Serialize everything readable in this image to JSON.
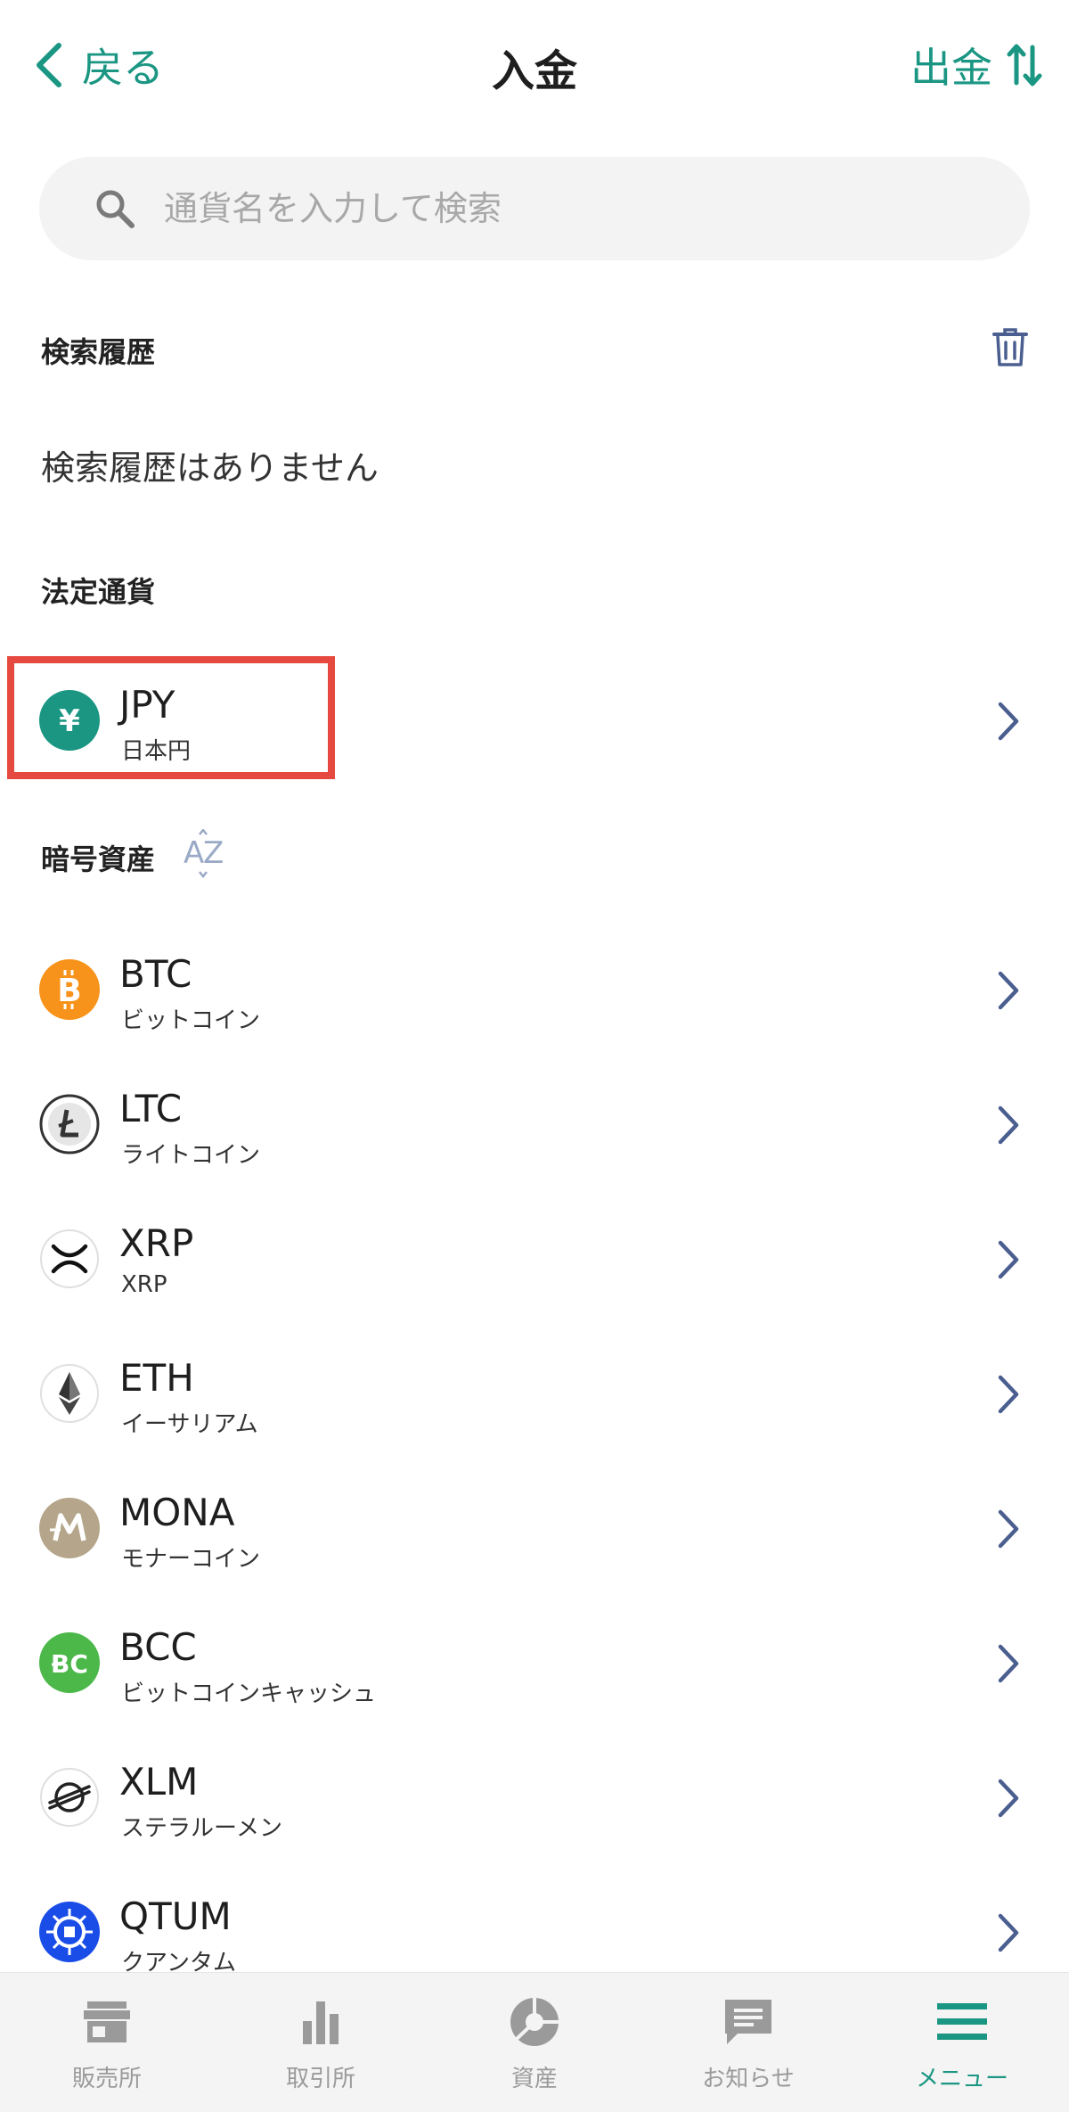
{
  "header": {
    "back_label": "戻る",
    "title": "入金",
    "withdraw_label": "出金"
  },
  "search": {
    "placeholder": "通貨名を入力して検索"
  },
  "history": {
    "title": "検索履歴",
    "empty": "検索履歴はありません"
  },
  "fiat": {
    "title": "法定通貨",
    "items": [
      {
        "code": "JPY",
        "name": "日本円",
        "icon": "yen-icon",
        "color": "#1a9683"
      }
    ]
  },
  "crypto": {
    "title": "暗号資産",
    "sort_icon": "sort-az-icon",
    "items": [
      {
        "code": "BTC",
        "name": "ビットコイン",
        "icon": "bitcoin-icon",
        "color": "#f7931a"
      },
      {
        "code": "LTC",
        "name": "ライトコイン",
        "icon": "litecoin-icon",
        "color": "#333333"
      },
      {
        "code": "XRP",
        "name": "XRP",
        "icon": "xrp-icon",
        "color": "#111111"
      },
      {
        "code": "ETH",
        "name": "イーサリアム",
        "icon": "ethereum-icon",
        "color": "#333333"
      },
      {
        "code": "MONA",
        "name": "モナーコイン",
        "icon": "monacoin-icon",
        "color": "#b5a68b"
      },
      {
        "code": "BCC",
        "name": "ビットコインキャッシュ",
        "icon": "bitcoin-cash-icon",
        "color": "#4cb84a"
      },
      {
        "code": "XLM",
        "name": "ステラルーメン",
        "icon": "stellar-icon",
        "color": "#222222"
      },
      {
        "code": "QTUM",
        "name": "クアンタム",
        "icon": "qtum-icon",
        "color": "#1a4de8"
      }
    ]
  },
  "bottom_nav": {
    "items": [
      {
        "label": "販売所",
        "icon": "store-icon",
        "active": false
      },
      {
        "label": "取引所",
        "icon": "bar-chart-icon",
        "active": false
      },
      {
        "label": "資産",
        "icon": "pie-chart-icon",
        "active": false
      },
      {
        "label": "お知らせ",
        "icon": "message-icon",
        "active": false
      },
      {
        "label": "メニュー",
        "icon": "menu-icon",
        "active": true
      }
    ]
  },
  "colors": {
    "accent": "#1a9683",
    "chevron": "#4a5f8f",
    "highlight": "#e5493f",
    "nav_inactive": "#9a9a9a"
  }
}
